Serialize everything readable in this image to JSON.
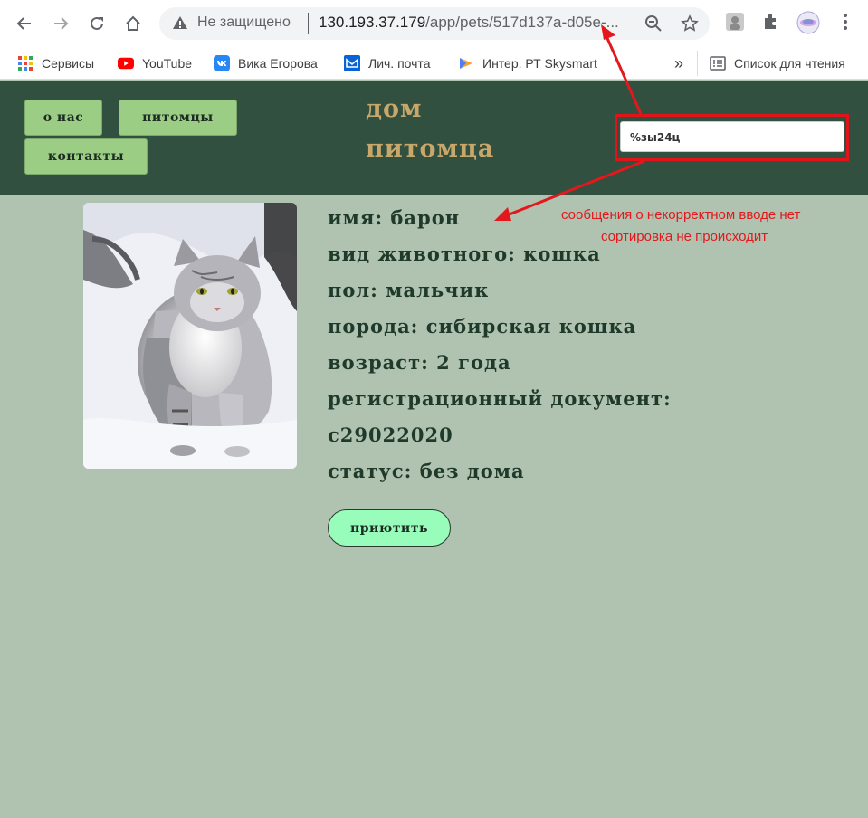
{
  "browser": {
    "insecure_label": "Не защищено",
    "url_host": "130.193.37.179",
    "url_path": "/app/pets/517d137a-d05e-..."
  },
  "bookmarks": [
    {
      "label": "Сервисы",
      "icon": "apps-grid-icon"
    },
    {
      "label": "YouTube",
      "icon": "youtube-icon"
    },
    {
      "label": "Вика Егорова",
      "icon": "vk-icon"
    },
    {
      "label": "Лич. почта",
      "icon": "mail-icon"
    },
    {
      "label": "Интер. РТ Skysmart",
      "icon": "skysmart-icon"
    }
  ],
  "bookmarks_more": "»",
  "reading_list_label": "Список для чтения",
  "site": {
    "menu": [
      {
        "label": "о нас"
      },
      {
        "label": "питомцы"
      },
      {
        "label": "контакты"
      }
    ],
    "logo_line1": "дом",
    "logo_line2": "питомца",
    "search_value": "%зы24ц"
  },
  "pet": {
    "name_line": "имя: Барон",
    "species_line": "вид животного: кошка",
    "gender_line": "пол: мальчик",
    "breed_line": "порода: сибирская кошка",
    "age_line": "возраст: 2 года",
    "doc_line": "регистрационный документ:",
    "doc_value": "С29022020",
    "status_line": "статус: без дома",
    "adopt_label": "приютить"
  },
  "annotations": {
    "note_line1": "сообщения о некорректном вводе нет",
    "note_line2": "сортировка не происходит"
  },
  "colors": {
    "header_bg": "#31503f",
    "page_bg": "#b0c2b0",
    "menu_btn": "#9bcd85",
    "logo": "#c8a76a",
    "adopt_btn": "#98fcbb",
    "annotation": "#e3181c"
  }
}
